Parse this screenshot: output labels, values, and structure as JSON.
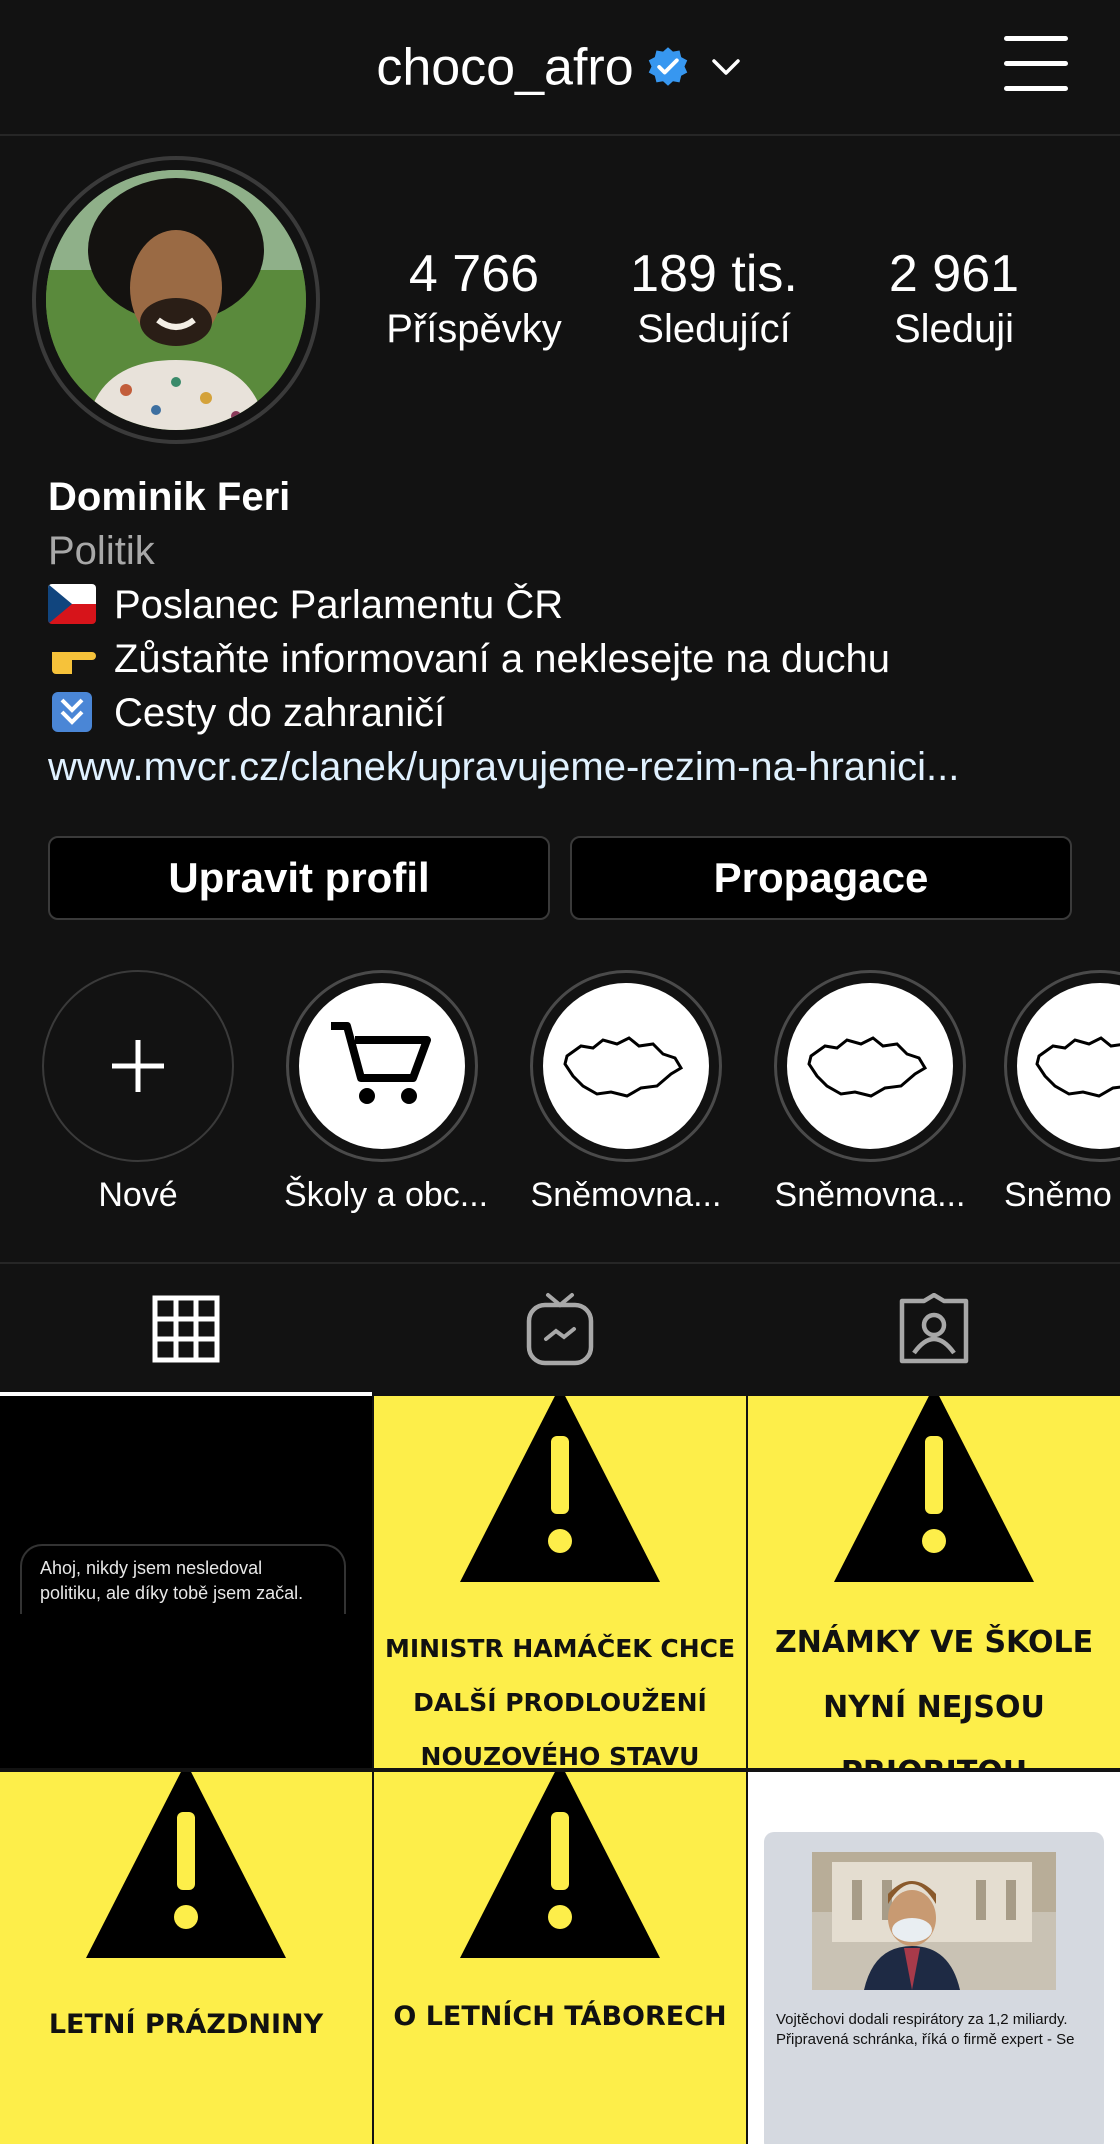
{
  "header": {
    "username": "choco_afro"
  },
  "profile": {
    "stats": [
      {
        "value": "4 766",
        "label": "Příspěvky"
      },
      {
        "value": "189 tis.",
        "label": "Sledující"
      },
      {
        "value": "2 961",
        "label": "Sleduji"
      }
    ],
    "name": "Dominik Feri",
    "category": "Politik",
    "bio_lines": [
      "Poslanec Parlamentu ČR",
      "Zůstaňte informovaní a neklesejte na duchu",
      "Cesty do zahraničí"
    ],
    "link": "www.mvcr.cz/clanek/upravujeme-rezim-na-hranici..."
  },
  "buttons": {
    "edit": "Upravit profil",
    "promote": "Propagace"
  },
  "highlights": [
    {
      "label": "Nové"
    },
    {
      "label": "Školy a obc..."
    },
    {
      "label": "Sněmovna..."
    },
    {
      "label": "Sněmovna..."
    },
    {
      "label": "Sněmo"
    }
  ],
  "posts": {
    "p1_text": "Ahoj, nikdy jsem nesledoval politiku, ale díky tobě jsem začal.",
    "p2_lines": [
      "MINISTR HAMÁČEK CHCE",
      "DALŠÍ PRODLOUŽENÍ",
      "NOUZOVÉHO STAVU"
    ],
    "p3_lines": [
      "ZNÁMKY VE ŠKOLE",
      "NYNÍ NEJSOU",
      "PRIORITOU"
    ],
    "p4_line": "LETNÍ PRÁZDNINY",
    "p5_line": "O LETNÍCH TÁBORECH",
    "p6_caption": "Vojtěchovi dodali respirátory za 1,2 miliardy. Připravená schránka, říká o firmě expert - Se"
  },
  "colors": {
    "background": "#121212",
    "warning_yellow": "#fdee4a",
    "verified": "#3797f0"
  }
}
